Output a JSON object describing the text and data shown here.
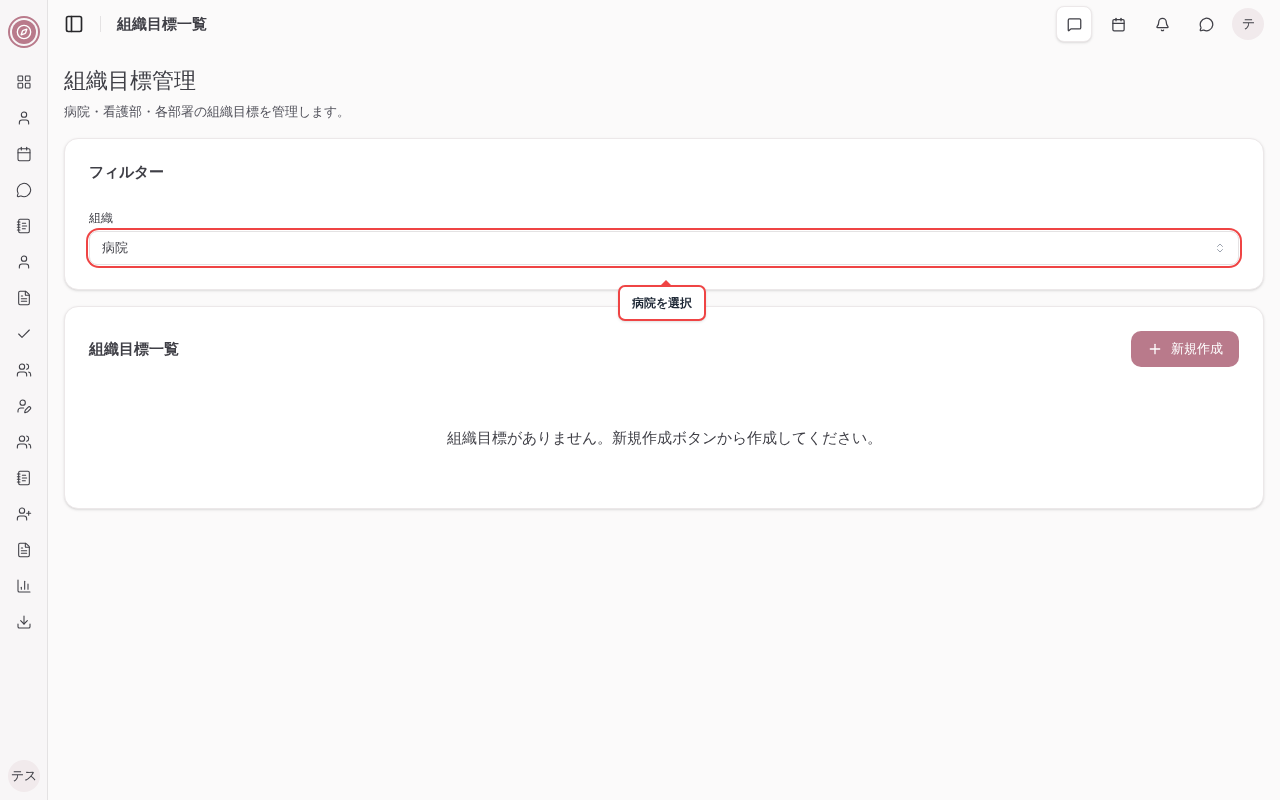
{
  "header": {
    "title": "組織目標一覧",
    "avatar": "テ"
  },
  "page": {
    "title": "組織目標管理",
    "subtitle": "病院・看護部・各部署の組織目標を管理します。"
  },
  "filter": {
    "title": "フィルター",
    "label": "組織",
    "value": "病院",
    "highlighted": true,
    "tooltip": "病院を選択"
  },
  "list": {
    "title": "組織目標一覧",
    "new_button": "新規作成",
    "empty": "組織目標がありません。新規作成ボタンから作成してください。"
  },
  "sidebar": {
    "user": "テス"
  }
}
